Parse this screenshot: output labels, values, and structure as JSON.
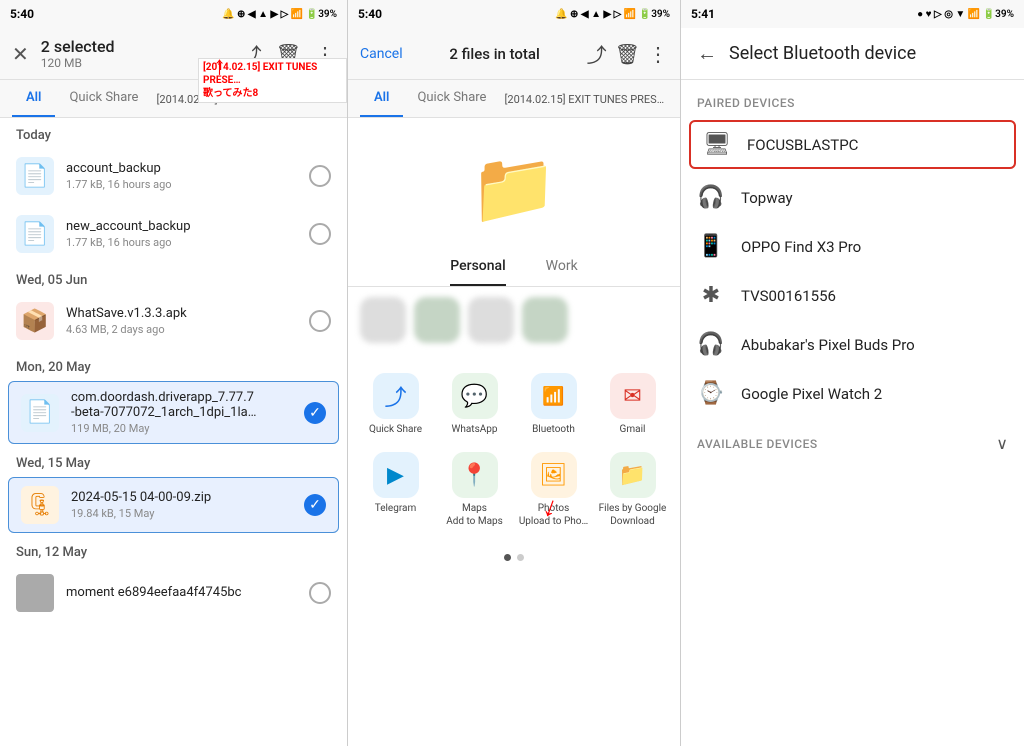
{
  "panel1": {
    "status": {
      "time": "5:40",
      "icons": "🔔 ⊕ ◀ ▲ ▶ ▷ 🔋 39%"
    },
    "toolbar": {
      "close": "✕",
      "title": "2 selected",
      "subtitle": "120 MB",
      "share_icon": "⤴",
      "delete_icon": "🗑",
      "more_icon": "⋮"
    },
    "tabs": {
      "all": "All",
      "quick_share": "Quick Share",
      "extra": "[2014.02.15] EXIT TUNES PRESE… 歌ってみた8"
    },
    "sections": [
      {
        "header": "Today",
        "items": [
          {
            "name": "account_backup",
            "meta": "1.77 kB, 16 hours ago",
            "type": "blue",
            "selected": false
          },
          {
            "name": "new_account_backup",
            "meta": "1.77 kB, 16 hours ago",
            "type": "blue",
            "selected": false
          }
        ]
      },
      {
        "header": "Wed, 05 Jun",
        "items": [
          {
            "name": "WhatSave.v1.3.3.apk",
            "meta": "4.63 MB, 2 days ago",
            "type": "red",
            "selected": false
          }
        ]
      },
      {
        "header": "Mon, 20 May",
        "items": [
          {
            "name": "com.doordash.driverapp_7.77.7-beta-7077072_1arch_1dpi_1la…",
            "meta": "119 MB, 20 May",
            "type": "blue",
            "selected": true,
            "highlighted": true
          }
        ]
      },
      {
        "header": "Wed, 15 May",
        "items": [
          {
            "name": "2024-05-15 04-00-09.zip",
            "meta": "19.84 kB, 15 May",
            "type": "orange",
            "selected": true,
            "highlighted": true
          }
        ]
      },
      {
        "header": "Sun, 12 May",
        "items": [
          {
            "name": "moment e6894eefaa4f4745bc",
            "meta": "",
            "type": "thumb",
            "selected": false
          }
        ]
      }
    ],
    "annotation": "[2014.02.15] EXIT TUNES PRESE…"
  },
  "panel2": {
    "status": {
      "time": "5:40",
      "icons": "🔔 ⊕ ◀ ▲ ▶ ▷ 🔋 39%"
    },
    "toolbar": {
      "cancel": "Cancel",
      "title": "2 files in total",
      "share_icon": "⤴",
      "delete_icon": "🗑",
      "more_icon": "⋮"
    },
    "tabs": {
      "all": "All",
      "quick_share": "Quick Share",
      "extra": "[2014.02.15] EXIT TUNES PRESE… 歌ってみた8"
    },
    "share_tabs": {
      "personal": "Personal",
      "work": "Work"
    },
    "apps": [
      {
        "id": "quick-share",
        "label": "Quick Share",
        "icon": "⤴",
        "style": "app-quickshare"
      },
      {
        "id": "whatsapp",
        "label": "WhatsApp",
        "icon": "💬",
        "style": "app-whatsapp"
      },
      {
        "id": "bluetooth",
        "label": "Bluetooth",
        "icon": "⚡",
        "style": "app-bluetooth"
      },
      {
        "id": "gmail",
        "label": "Gmail",
        "icon": "✉",
        "style": "app-gmail"
      },
      {
        "id": "telegram",
        "label": "Telegram",
        "icon": "▶",
        "style": "app-telegram"
      },
      {
        "id": "maps",
        "label": "Maps\nAdd to Maps",
        "icon": "📍",
        "style": "app-maps"
      },
      {
        "id": "photos",
        "label": "Photos\nUpload to Pho…",
        "icon": "🖼",
        "style": "app-photos"
      },
      {
        "id": "files",
        "label": "Files by Google\nDownload",
        "icon": "📁",
        "style": "app-files"
      }
    ]
  },
  "panel3": {
    "status": {
      "time": "5:41",
      "icons": "🔋 39%"
    },
    "header": {
      "back": "←",
      "title": "Select Bluetooth device"
    },
    "sections": {
      "paired": {
        "label": "Paired devices",
        "devices": [
          {
            "id": "focusblastpc",
            "name": "FOCUSBLASTPC",
            "icon": "🖥",
            "highlighted": true
          },
          {
            "id": "topway",
            "name": "Topway",
            "icon": "🎧",
            "highlighted": false
          },
          {
            "id": "oppo",
            "name": "OPPO Find X3 Pro",
            "icon": "📱",
            "highlighted": false
          },
          {
            "id": "tvs",
            "name": "TVS00161556",
            "icon": "✱",
            "highlighted": false
          },
          {
            "id": "pixelbuds",
            "name": "Abubakar's Pixel Buds Pro",
            "icon": "🎧",
            "highlighted": false
          },
          {
            "id": "pixelwatch",
            "name": "Google Pixel Watch 2",
            "icon": "⌚",
            "highlighted": false
          }
        ]
      },
      "available": {
        "label": "Available devices"
      }
    }
  }
}
